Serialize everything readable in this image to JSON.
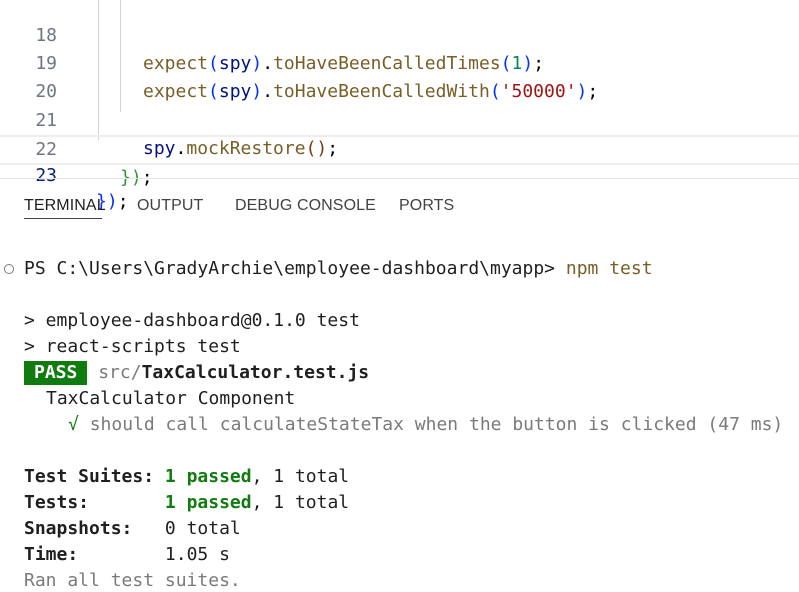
{
  "editor": {
    "lines": [
      {
        "number": "18",
        "text": "expect(spy).toHaveBeenCalledTimes(1);"
      },
      {
        "number": "19",
        "text": "expect(spy).toHaveBeenCalledWith('50000');"
      },
      {
        "number": "20",
        "text": ""
      },
      {
        "number": "21",
        "text": "spy.mockRestore();"
      },
      {
        "number": "22",
        "text": "});"
      },
      {
        "number": "23",
        "text": "});"
      }
    ],
    "tokens": {
      "expect": "expect",
      "spy": "spy",
      "to_have_been_called_times": "toHaveBeenCalledTimes",
      "to_have_been_called_with": "toHaveBeenCalledWith",
      "mock_restore": "mockRestore",
      "num_one": "1",
      "str_50000": "'50000'"
    }
  },
  "panel": {
    "tabs": [
      {
        "label": "TERMINAL",
        "active": true
      },
      {
        "label": "OUTPUT",
        "active": false
      },
      {
        "label": "DEBUG CONSOLE",
        "active": false
      },
      {
        "label": "PORTS",
        "active": false
      }
    ]
  },
  "terminal": {
    "prompt": "PS C:\\Users\\GradyArchie\\employee-dashboard\\myapp>",
    "command": "npm test",
    "script_line_1": "> employee-dashboard@0.1.0 test",
    "script_line_2": "> react-scripts test",
    "pass_label": "PASS",
    "test_dir": "src/",
    "test_file": "TaxCalculator.test.js",
    "describe_name": "TaxCalculator Component",
    "check_mark": "√",
    "test_name": "should call calculateStateTax when the button is clicked (47 ms)",
    "summary": {
      "suites_label": "Test Suites:",
      "suites_passed": "1 passed",
      "suites_total": ", 1 total",
      "tests_label": "Tests:",
      "tests_passed": "1 passed",
      "tests_total": ", 1 total",
      "snapshots_label": "Snapshots:",
      "snapshots_value": "0 total",
      "time_label": "Time:",
      "time_value": "1.05 s",
      "footer": "Ran all test suites."
    }
  },
  "colors": {
    "pass_badge": "#107c10",
    "passed_text": "#107c10",
    "string": "#a31515",
    "number": "#098658",
    "function": "#795e26",
    "variable": "#001080"
  }
}
